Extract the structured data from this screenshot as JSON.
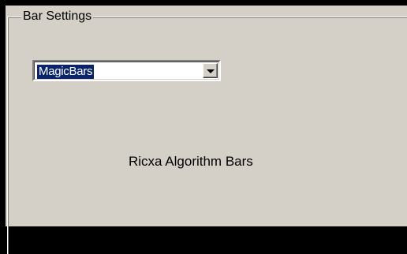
{
  "groupbox": {
    "title": "Bar Settings"
  },
  "combo": {
    "selected": "MagicBars",
    "button_icon": "chevron-down-icon"
  },
  "caption": "Ricxa Algorithm Bars"
}
